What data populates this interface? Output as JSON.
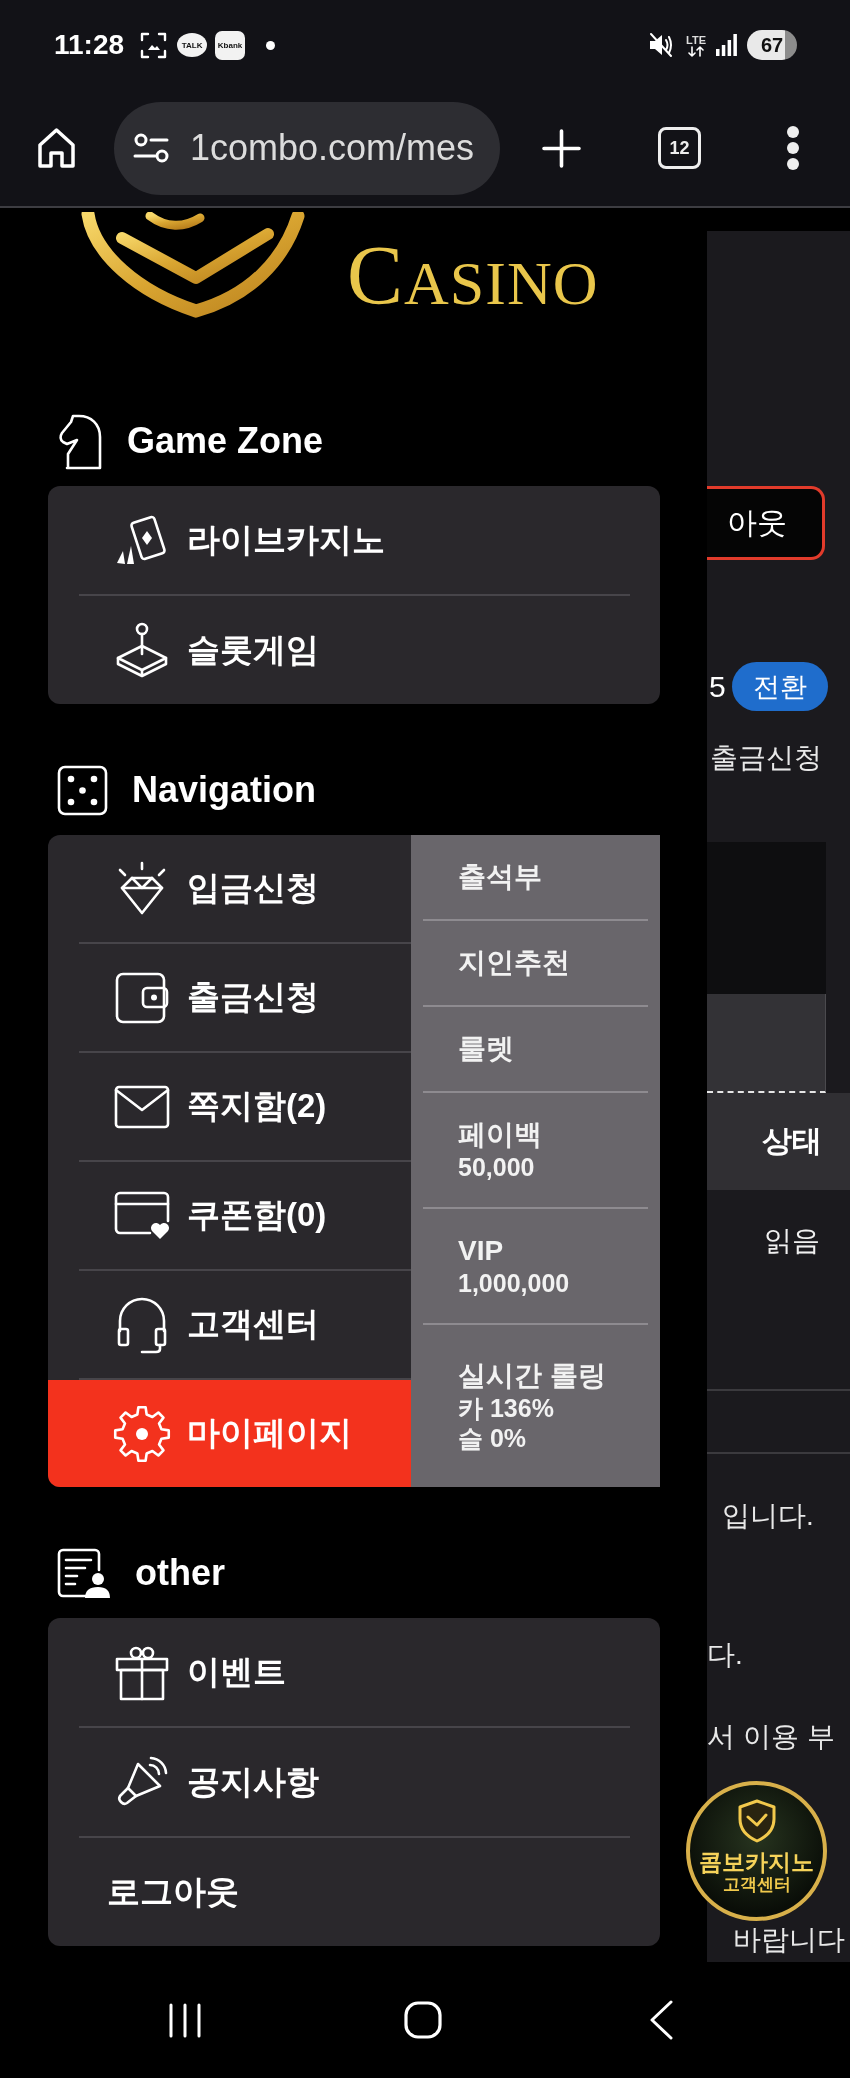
{
  "status_bar": {
    "time": "11:28",
    "app_badges": [
      {
        "kind": "bubble",
        "label": "TALK"
      },
      {
        "kind": "tile",
        "label": "Kbank"
      }
    ],
    "network": "LTE",
    "battery": "67"
  },
  "browser": {
    "url": "1combo.com/mes",
    "tab_count": "12"
  },
  "logo": {
    "text": "CASINO"
  },
  "menu": {
    "sections": [
      {
        "title": "Game Zone",
        "items": [
          {
            "label": "라이브카지노",
            "selected": false
          },
          {
            "label": "슬롯게임",
            "selected": false
          }
        ]
      },
      {
        "title": "Navigation",
        "items": [
          {
            "label": "입금신청",
            "selected": false
          },
          {
            "label": "출금신청",
            "selected": false
          },
          {
            "label": "쪽지함(2)",
            "selected": false
          },
          {
            "label": "쿠폰함(0)",
            "selected": false
          },
          {
            "label": "고객센터",
            "selected": false
          },
          {
            "label": "마이페이지",
            "selected": true
          }
        ],
        "submenu": [
          {
            "label": "출석부"
          },
          {
            "label": "지인추천"
          },
          {
            "label": "룰렛"
          },
          {
            "label": "페이백",
            "details": [
              "50,000"
            ]
          },
          {
            "label": "VIP",
            "details": [
              "1,000,000"
            ]
          },
          {
            "label": "실시간 롤링",
            "details": [
              "카 136%",
              "슬 0%"
            ]
          }
        ]
      },
      {
        "title": "other",
        "items": [
          {
            "label": "이벤트",
            "selected": false
          },
          {
            "label": "공지사항",
            "selected": false
          },
          {
            "label": "로그아웃",
            "selected": false
          }
        ]
      }
    ]
  },
  "page_behind": {
    "logout_button": "아웃",
    "balance": "5",
    "switch_button": "전환",
    "withdraw_link": "출금신청",
    "table": {
      "columns": [
        "상태"
      ],
      "rows": [
        [
          "읽음"
        ]
      ]
    },
    "notice_fragments": [
      "입니다.",
      "다.",
      "서 이용 부",
      "바랍니다"
    ]
  },
  "support_badge": {
    "title": "콤보카지노",
    "subtitle": "고객센터"
  }
}
